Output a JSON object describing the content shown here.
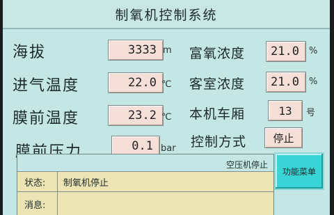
{
  "window": {
    "title": "制氧机控制系统"
  },
  "left_params": [
    {
      "label": "海拔",
      "value": "3333",
      "unit": "m"
    },
    {
      "label": "进气温度",
      "value": "22.0",
      "unit": "℃"
    },
    {
      "label": "膜前温度",
      "value": "23.2",
      "unit": "℃"
    },
    {
      "label": "膜前压力",
      "value": "0.1",
      "unit": "bar"
    }
  ],
  "right_params": [
    {
      "label": "富氧浓度",
      "value": "21.0",
      "unit": "%"
    },
    {
      "label": "客室浓度",
      "value": "21.0",
      "unit": "%"
    },
    {
      "label": "本机车厢",
      "value": "13",
      "unit": "号"
    },
    {
      "label": "控制方式",
      "value": "停止",
      "unit": ""
    }
  ],
  "status": {
    "status_label": "状态:",
    "status_value": "制氧机停止",
    "compressor_status": "空压机停止",
    "message_label": "消息:",
    "message_value": ""
  },
  "function_button": {
    "label": "功能菜单"
  },
  "colors": {
    "panel_bg": "#c4e6e4",
    "field_bg": "#f6dfd8",
    "status_bg": "#ece4b4",
    "button_bg": "#39d4d6"
  }
}
